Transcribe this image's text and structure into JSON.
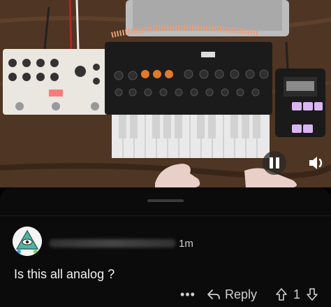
{
  "video": {
    "pause_icon": "pause-icon",
    "volume_icon": "volume-icon"
  },
  "comment": {
    "timestamp": "1m",
    "text": "Is this all analog ?",
    "more_label": "•••",
    "reply_label": "Reply",
    "vote_count": "1"
  },
  "colors": {
    "sheet_bg": "#0b0b0b",
    "knob_orange": "#e07a2c",
    "pad_purple": "#d9b6f2"
  }
}
